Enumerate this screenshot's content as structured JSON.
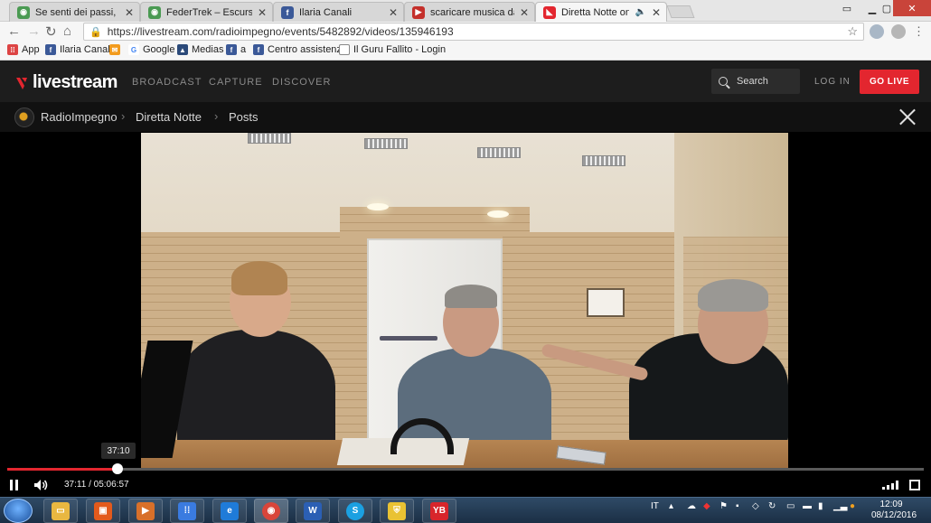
{
  "browser": {
    "tabs": [
      {
        "title": "Se senti dei passi, mettiti",
        "icon": "chrome-icon",
        "active": false
      },
      {
        "title": "FederTrek – Escursionism",
        "icon": "chrome-icon",
        "active": false
      },
      {
        "title": "Ilaria Canali",
        "icon": "facebook-icon",
        "active": false
      },
      {
        "title": "scaricare musica da yout",
        "icon": "youtube-icon",
        "active": false
      },
      {
        "title": "Diretta Notte on Live",
        "icon": "livestream-icon",
        "active": true
      }
    ],
    "url": "https://livestream.com/radioimpegno/events/5482892/videos/135946193",
    "bookmarks": [
      "App",
      "Ilaria Canali",
      "",
      "Google",
      "Medias",
      "a",
      "Centro assistenza",
      "Il Guru Fallito - Login"
    ]
  },
  "site": {
    "logo": "livestream",
    "nav": [
      "BROADCAST",
      "CAPTURE",
      "DISCOVER"
    ],
    "search_placeholder": "Search",
    "login": "LOG IN",
    "golive": "GO LIVE"
  },
  "breadcrumb": [
    "RadioImpegno",
    "Diretta Notte",
    "Posts"
  ],
  "player": {
    "hover_time": "37:10",
    "current_time": "37:11",
    "duration": "05:06:57",
    "progress": 0.1208
  },
  "taskbar": {
    "language": "IT",
    "time": "12:09",
    "date": "08/12/2016"
  },
  "colors": {
    "accent": "#e3262f",
    "header_bg": "#1d1d1d"
  }
}
